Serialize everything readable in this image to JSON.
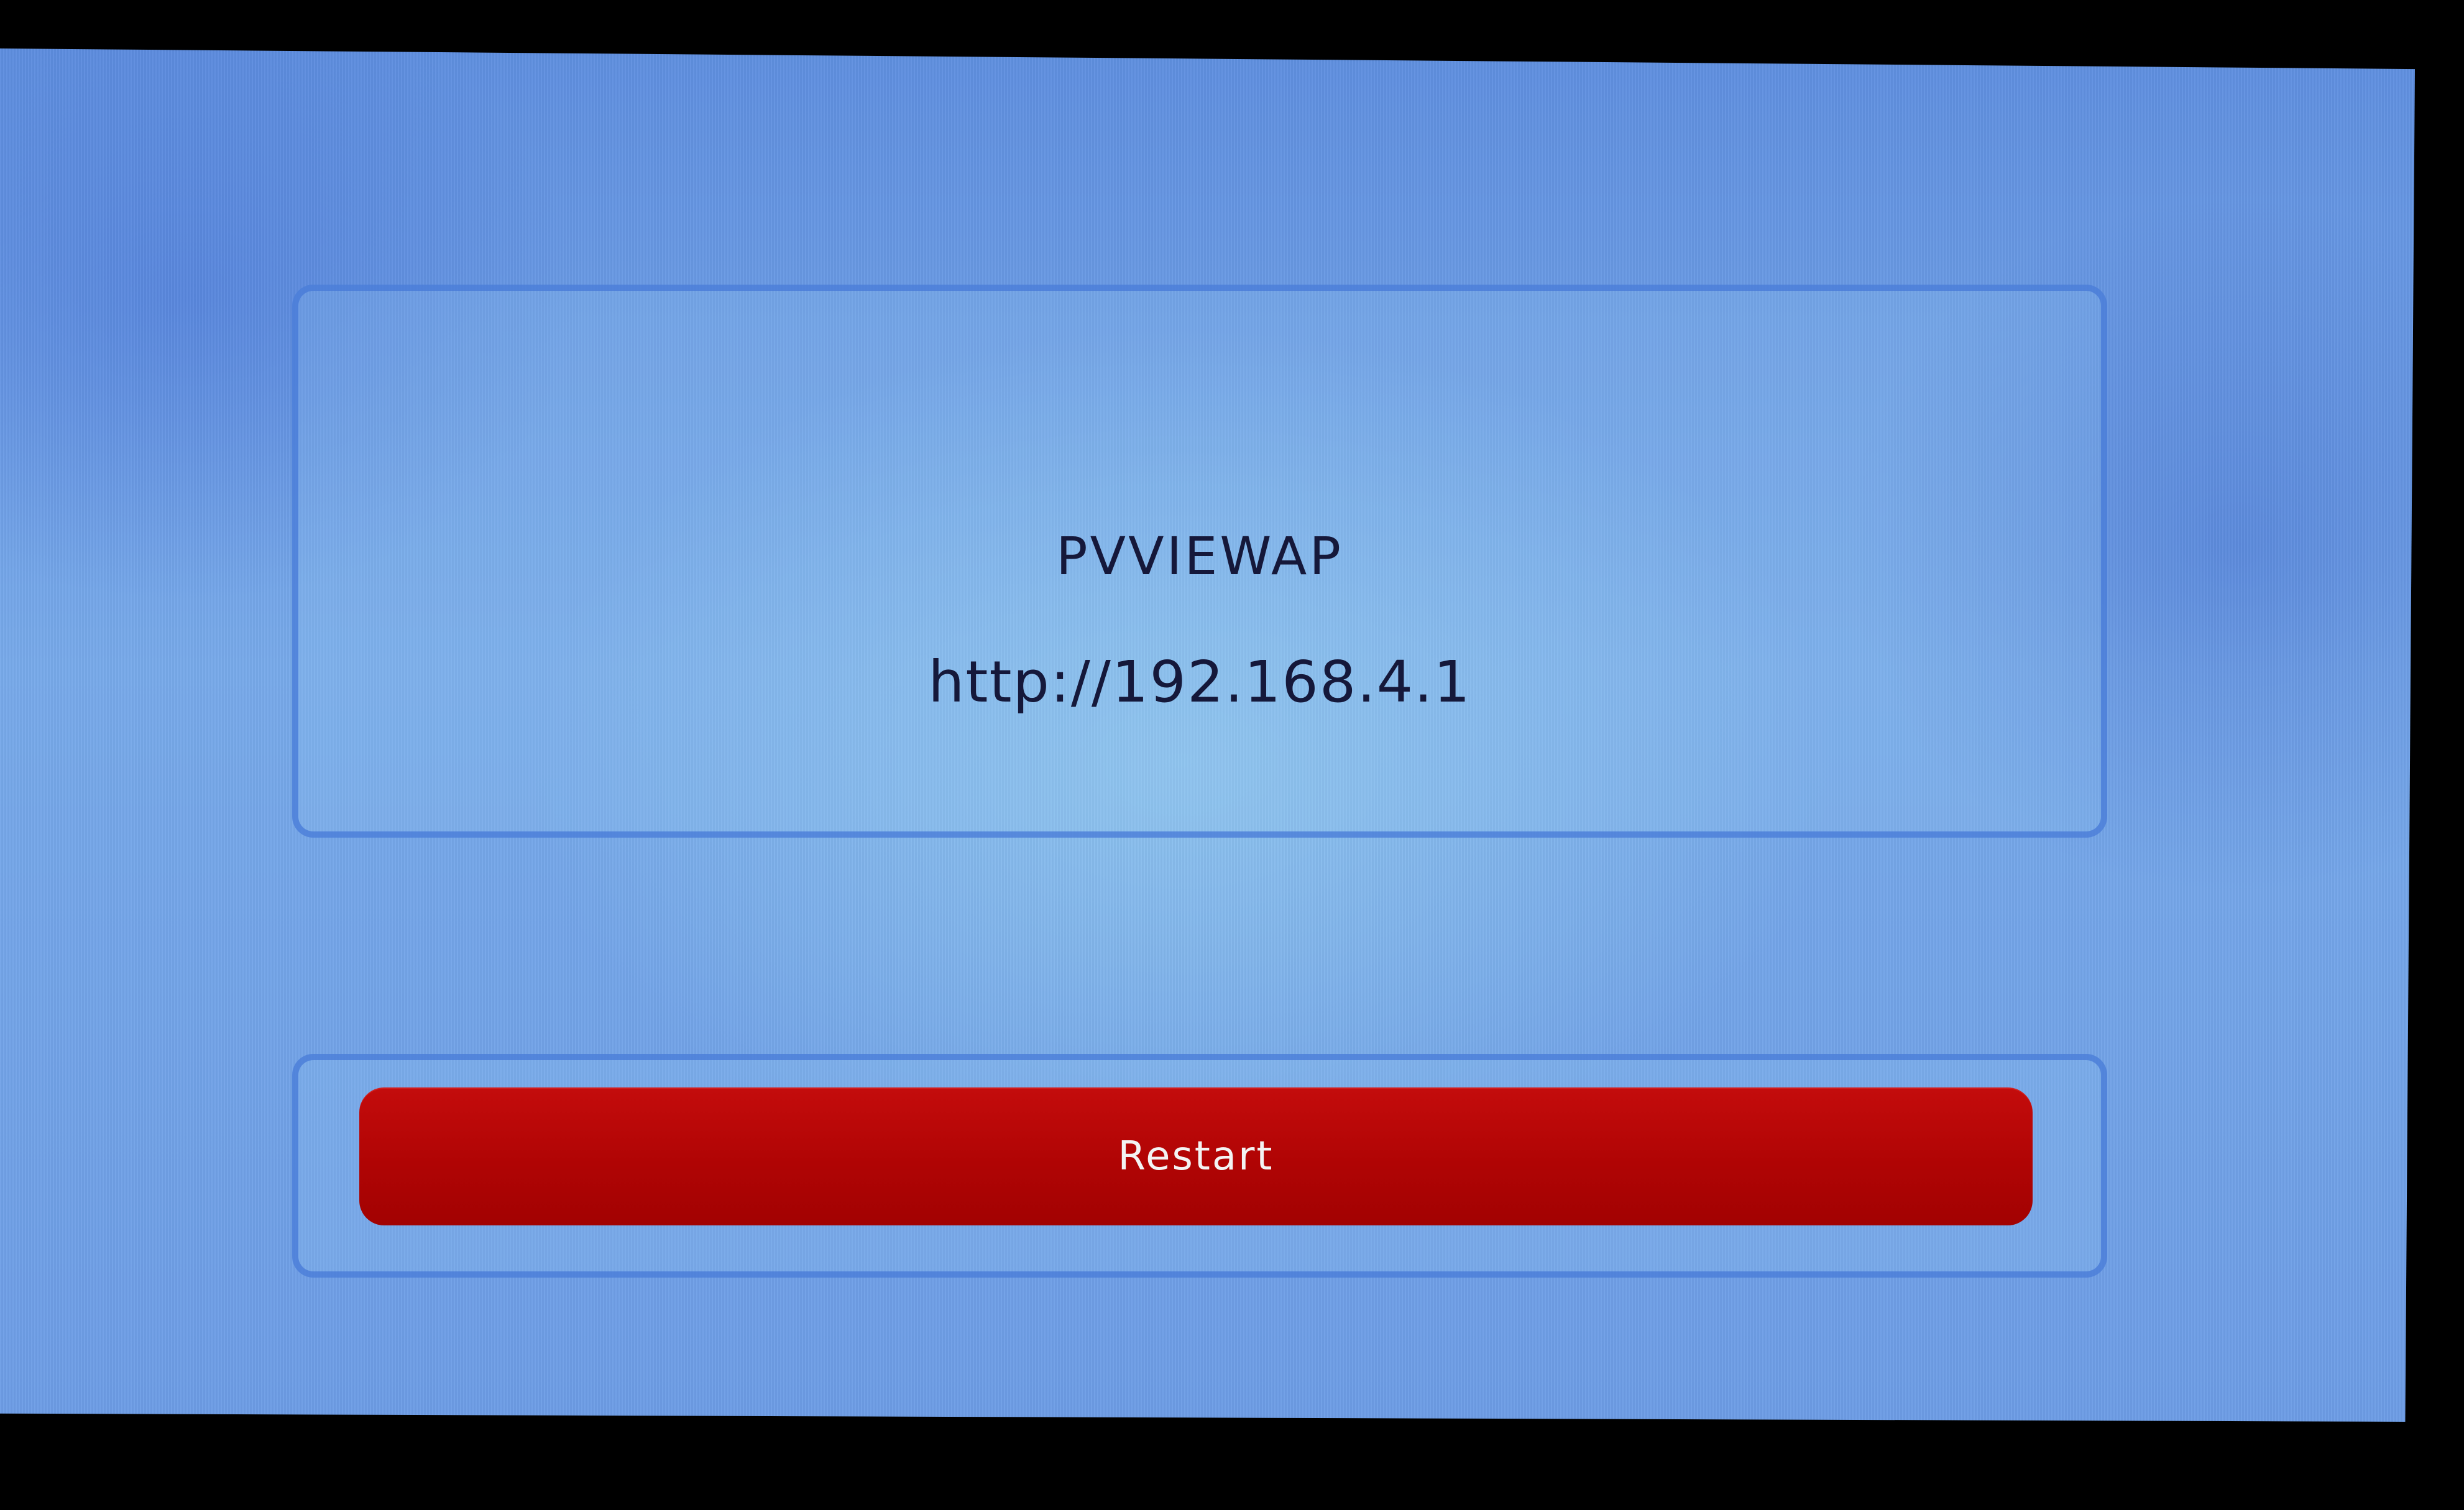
{
  "info": {
    "network_name": "PVVIEWAP",
    "address": "http://192.168.4.1"
  },
  "actions": {
    "restart_label": "Restart"
  },
  "colors": {
    "screen_background": "#6d9de6",
    "panel_border": "#4678d7",
    "text": "#15183a",
    "restart_button": "#b00404",
    "restart_text": "#f3f3f3"
  }
}
